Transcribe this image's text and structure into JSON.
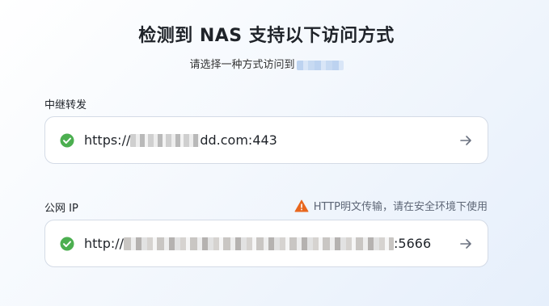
{
  "header": {
    "title": "检测到 NAS 支持以下访问方式",
    "subtitle": "请选择一种方式访问到"
  },
  "relay": {
    "label": "中继转发",
    "url_prefix": "https://",
    "url_suffix": "dd.com:443",
    "status_icon": "check-circle-icon",
    "go_icon": "arrow-right-icon"
  },
  "public_ip": {
    "label": "公网 IP",
    "warning": "HTTP明文传输，请在安全环境下使用",
    "warning_icon": "warning-triangle-icon",
    "url_prefix": "http://",
    "url_suffix": ":5666",
    "status_icon": "check-circle-icon",
    "go_icon": "arrow-right-icon"
  },
  "colors": {
    "success": "#4caf50",
    "warning": "#e8671e",
    "arrow": "#6b7280",
    "card_border": "#d4dbe6"
  }
}
